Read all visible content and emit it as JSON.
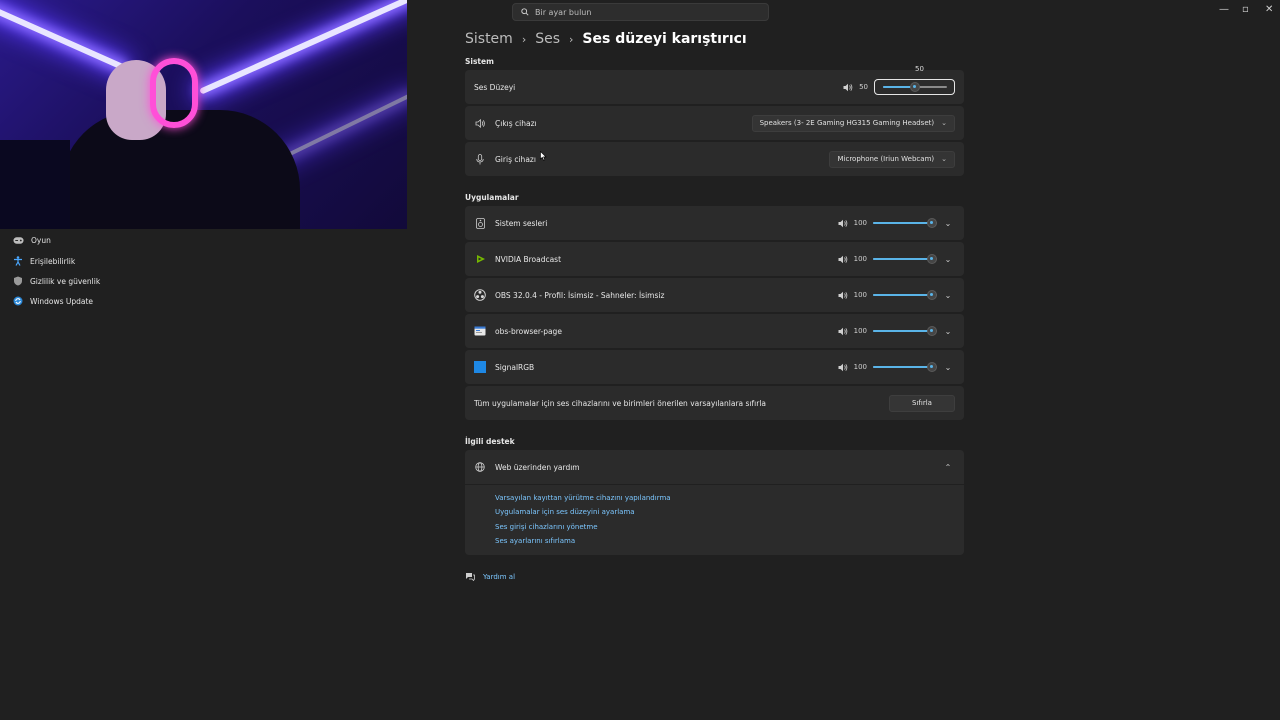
{
  "search": {
    "placeholder": "Bir ayar bulun"
  },
  "breadcrumb": {
    "items": [
      "Sistem",
      "Ses"
    ],
    "current": "Ses düzeyi karıştırıcı"
  },
  "sidebar": {
    "items": [
      {
        "label": "Oyun",
        "icon": "gamepad-icon"
      },
      {
        "label": "Erişilebilirlik",
        "icon": "accessibility-icon"
      },
      {
        "label": "Gizlilik ve güvenlik",
        "icon": "shield-icon"
      },
      {
        "label": "Windows Update",
        "icon": "update-icon"
      }
    ]
  },
  "system": {
    "title": "Sistem",
    "volume": {
      "label": "Ses Düzeyi",
      "value": "50",
      "tooltip": "50",
      "level": 0.5
    },
    "output": {
      "label": "Çıkış cihazı",
      "device": "Speakers (3- 2E Gaming HG315 Gaming Headset)"
    },
    "input": {
      "label": "Giriş cihazı",
      "device": "Microphone (Iriun Webcam)"
    }
  },
  "apps": {
    "title": "Uygulamalar",
    "items": [
      {
        "name": "Sistem sesleri",
        "value": "100",
        "level": 1.0,
        "icon": "system-sounds-icon"
      },
      {
        "name": "NVIDIA Broadcast",
        "value": "100",
        "level": 1.0,
        "icon": "nvidia-icon"
      },
      {
        "name": "OBS 32.0.4 - Profil: İsimsiz - Sahneler: İsimsiz",
        "value": "100",
        "level": 1.0,
        "icon": "obs-icon"
      },
      {
        "name": "obs-browser-page",
        "value": "100",
        "level": 1.0,
        "icon": "browser-page-icon"
      },
      {
        "name": "SignalRGB",
        "value": "100",
        "level": 1.0,
        "icon": "signalrgb-icon"
      }
    ],
    "reset": {
      "text": "Tüm uygulamalar için ses cihazlarını ve birimleri önerilen varsayılanlara sıfırla",
      "button": "Sıfırla"
    }
  },
  "support": {
    "title": "İlgili destek",
    "web": {
      "label": "Web üzerinden yardım"
    },
    "links": [
      "Varsayılan kayıttan yürütme cihazını yapılandırma",
      "Uygulamalar için ses düzeyini ayarlama",
      "Ses girişi cihazlarını yönetme",
      "Ses ayarlarını sıfırlama"
    ]
  },
  "help": {
    "label": "Yardım al"
  },
  "colors": {
    "accent": "#5ab4e8",
    "link": "#7cc7ff",
    "background": "#202020",
    "card": "#2b2b2b"
  }
}
